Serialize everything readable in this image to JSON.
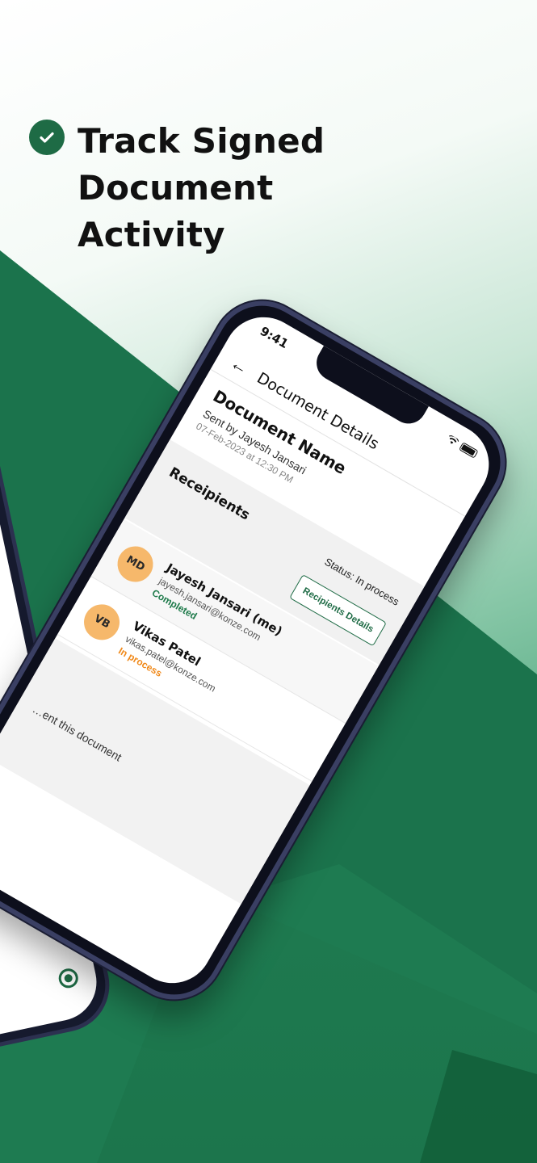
{
  "headline": {
    "line1": "Track Signed Document",
    "line2": "Activity",
    "icon": "check-circle-icon"
  },
  "phone": {
    "status_bar": {
      "time": "9:41"
    },
    "header": {
      "back_icon": "←",
      "title": "Document Details"
    },
    "document": {
      "name": "Document Name",
      "sent_by": "Sent by Jayesh Jansari",
      "date": "07-Feb-2023 at 12:30 PM"
    },
    "recipients_section": {
      "title": "Receipients",
      "status": "Status: In process",
      "details_button": "Recipients Details"
    },
    "recipients": [
      {
        "initials": "MD",
        "name": "Jayesh Jansari (me)",
        "email": "jayesh.jansari@konze.com",
        "status": "Completed"
      },
      {
        "initials": "VB",
        "name": "Vikas Patel",
        "email": "vikas.patel@konze.com",
        "status": "In process"
      }
    ],
    "footer_note": "…ent this document"
  },
  "colors": {
    "brand_green": "#1e6b45",
    "completed": "#1e7a4a",
    "in_process": "#f0891a",
    "avatar": "#f6b86b"
  }
}
